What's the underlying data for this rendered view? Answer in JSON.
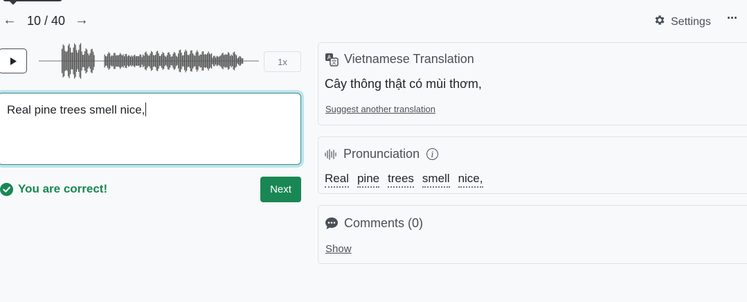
{
  "nav": {
    "prev_icon": "←",
    "next_icon": "→",
    "counter": "10 / 40",
    "settings_label": "Settings",
    "more_icon": "···"
  },
  "audio": {
    "play_icon": "play-icon",
    "speed_label": "1x"
  },
  "answer": {
    "value": "Real pine trees smell nice,"
  },
  "feedback": {
    "message": "You are correct!",
    "next_label": "Next",
    "success_color": "#198754"
  },
  "translation": {
    "title": "Vietnamese Translation",
    "text": "Cây thông thật có mùi thơm,",
    "suggest_link": "Suggest another translation"
  },
  "pronunciation": {
    "title": "Pronunciation",
    "words": [
      "Real",
      "pine",
      "trees",
      "smell",
      "nice,"
    ]
  },
  "comments": {
    "title": "Comments (0)",
    "show_link": "Show"
  }
}
